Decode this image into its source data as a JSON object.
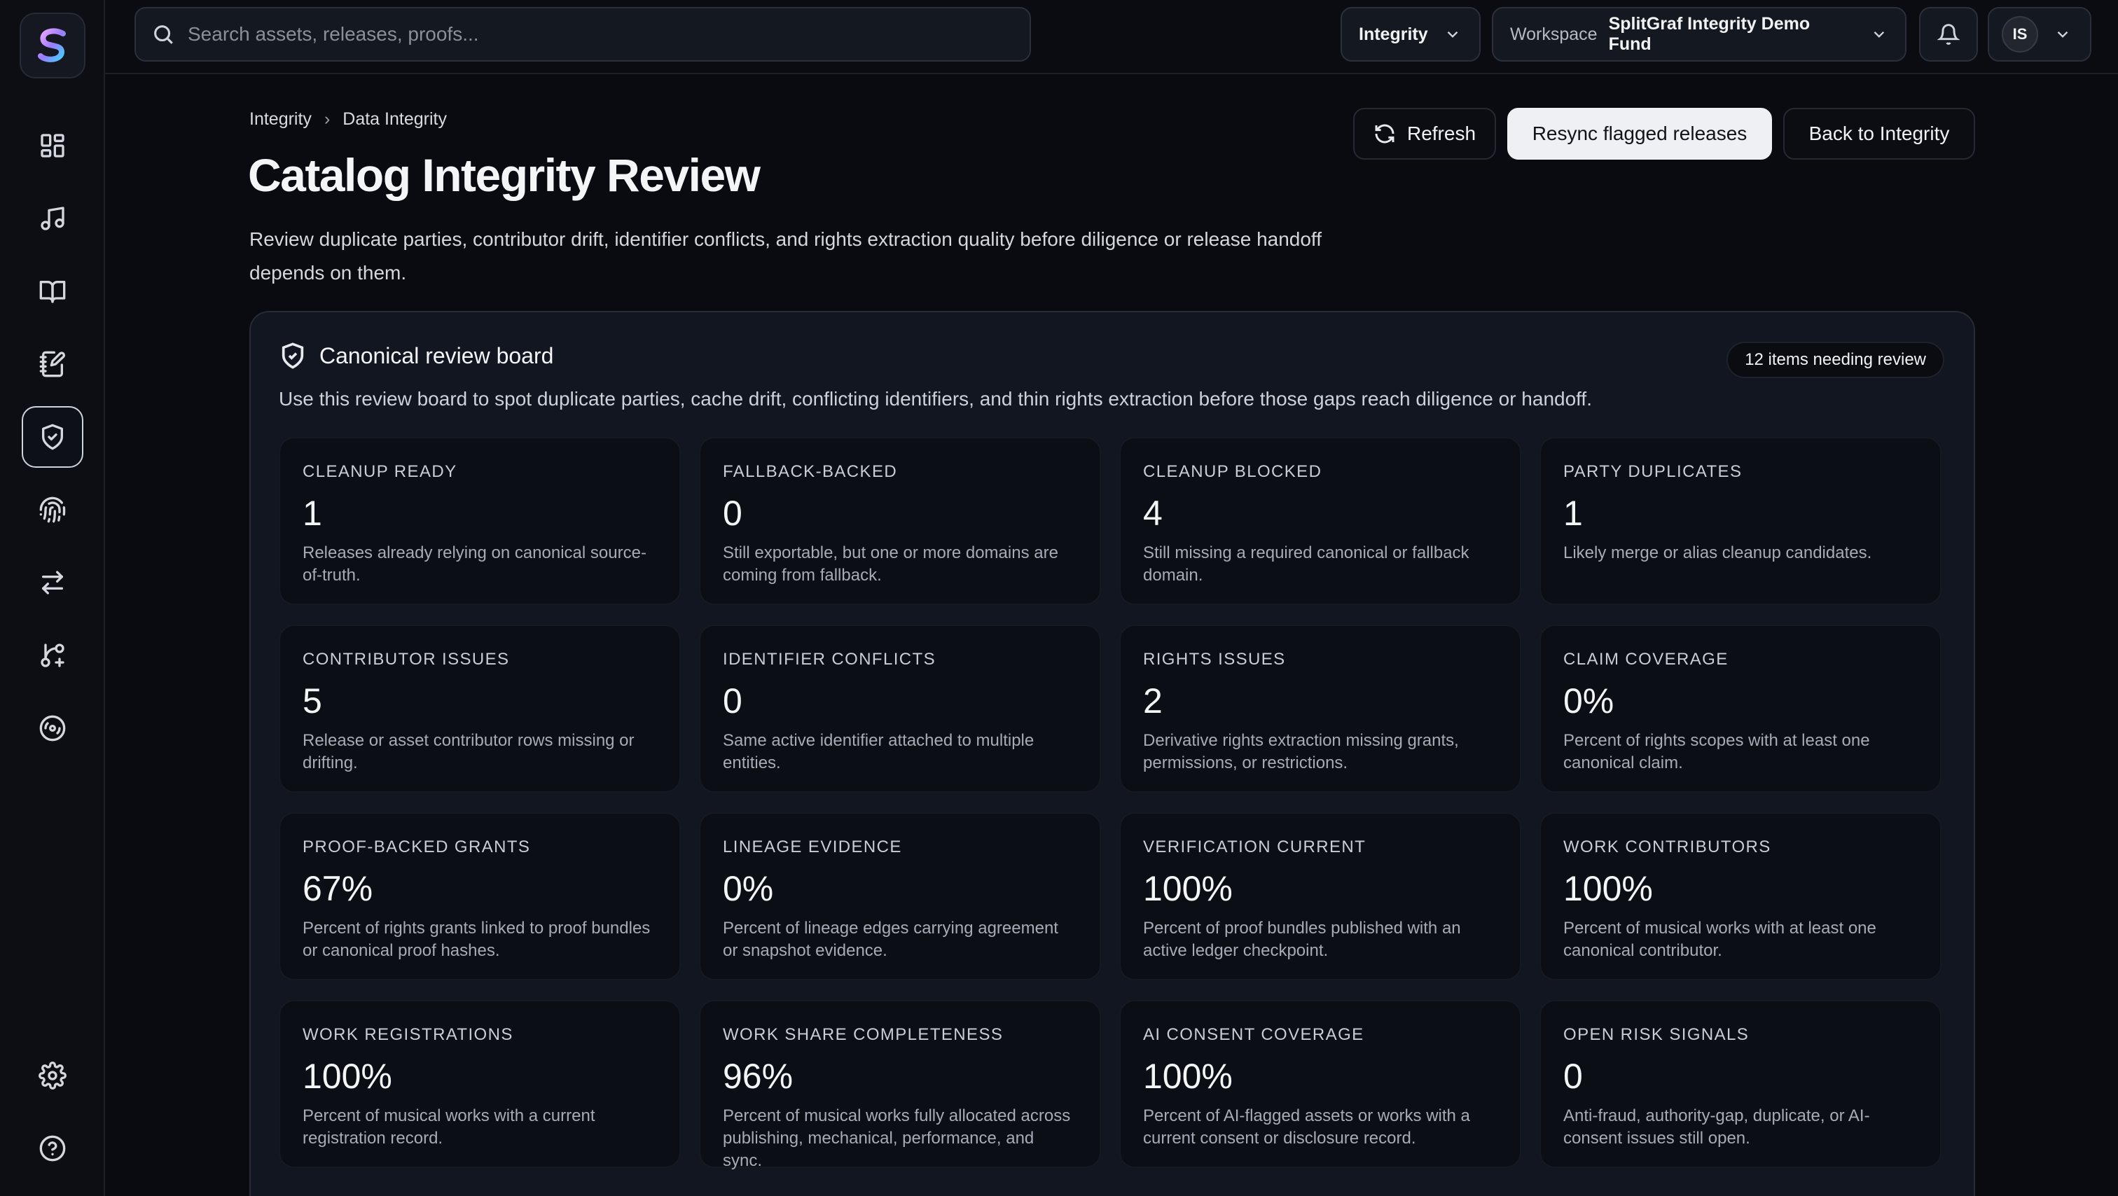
{
  "search": {
    "placeholder": "Search assets, releases, proofs..."
  },
  "topbar": {
    "module_label": "Integrity",
    "workspace_prefix": "Workspace",
    "workspace_name": "SplitGraf Integrity Demo Fund",
    "user_initials": "IS"
  },
  "breadcrumb": {
    "root": "Integrity",
    "sep": "›",
    "current": "Data Integrity"
  },
  "page": {
    "title": "Catalog Integrity Review",
    "description": "Review duplicate parties, contributor drift, identifier conflicts, and rights extraction quality before diligence or release handoff depends on them."
  },
  "actions": {
    "refresh": "Refresh",
    "resync": "Resync flagged releases",
    "back": "Back to Integrity"
  },
  "board": {
    "title": "Canonical review board",
    "badge": "12 items needing review",
    "description": "Use this review board to spot duplicate parties, cache drift, conflicting identifiers, and thin rights extraction before those gaps reach diligence or handoff.",
    "cards": [
      {
        "label": "Cleanup ready",
        "value": "1",
        "desc": "Releases already relying on canonical source-of-truth."
      },
      {
        "label": "Fallback-backed",
        "value": "0",
        "desc": "Still exportable, but one or more domains are coming from fallback."
      },
      {
        "label": "Cleanup blocked",
        "value": "4",
        "desc": "Still missing a required canonical or fallback domain."
      },
      {
        "label": "Party duplicates",
        "value": "1",
        "desc": "Likely merge or alias cleanup candidates."
      },
      {
        "label": "Contributor issues",
        "value": "5",
        "desc": "Release or asset contributor rows missing or drifting."
      },
      {
        "label": "Identifier conflicts",
        "value": "0",
        "desc": "Same active identifier attached to multiple entities."
      },
      {
        "label": "Rights issues",
        "value": "2",
        "desc": "Derivative rights extraction missing grants, permissions, or restrictions."
      },
      {
        "label": "Claim coverage",
        "value": "0%",
        "desc": "Percent of rights scopes with at least one canonical claim."
      },
      {
        "label": "Proof-backed grants",
        "value": "67%",
        "desc": "Percent of rights grants linked to proof bundles or canonical proof hashes."
      },
      {
        "label": "Lineage evidence",
        "value": "0%",
        "desc": "Percent of lineage edges carrying agreement or snapshot evidence."
      },
      {
        "label": "Verification current",
        "value": "100%",
        "desc": "Percent of proof bundles published with an active ledger checkpoint."
      },
      {
        "label": "Work contributors",
        "value": "100%",
        "desc": "Percent of musical works with at least one canonical contributor."
      },
      {
        "label": "Work registrations",
        "value": "100%",
        "desc": "Percent of musical works with a current registration record."
      },
      {
        "label": "Work share completeness",
        "value": "96%",
        "desc": "Percent of musical works fully allocated across publishing, mechanical, performance, and sync."
      },
      {
        "label": "AI consent coverage",
        "value": "100%",
        "desc": "Percent of AI-flagged assets or works with a current consent or disclosure record."
      },
      {
        "label": "Open risk signals",
        "value": "0",
        "desc": "Anti-fraud, authority-gap, duplicate, or AI-consent issues still open."
      }
    ]
  }
}
